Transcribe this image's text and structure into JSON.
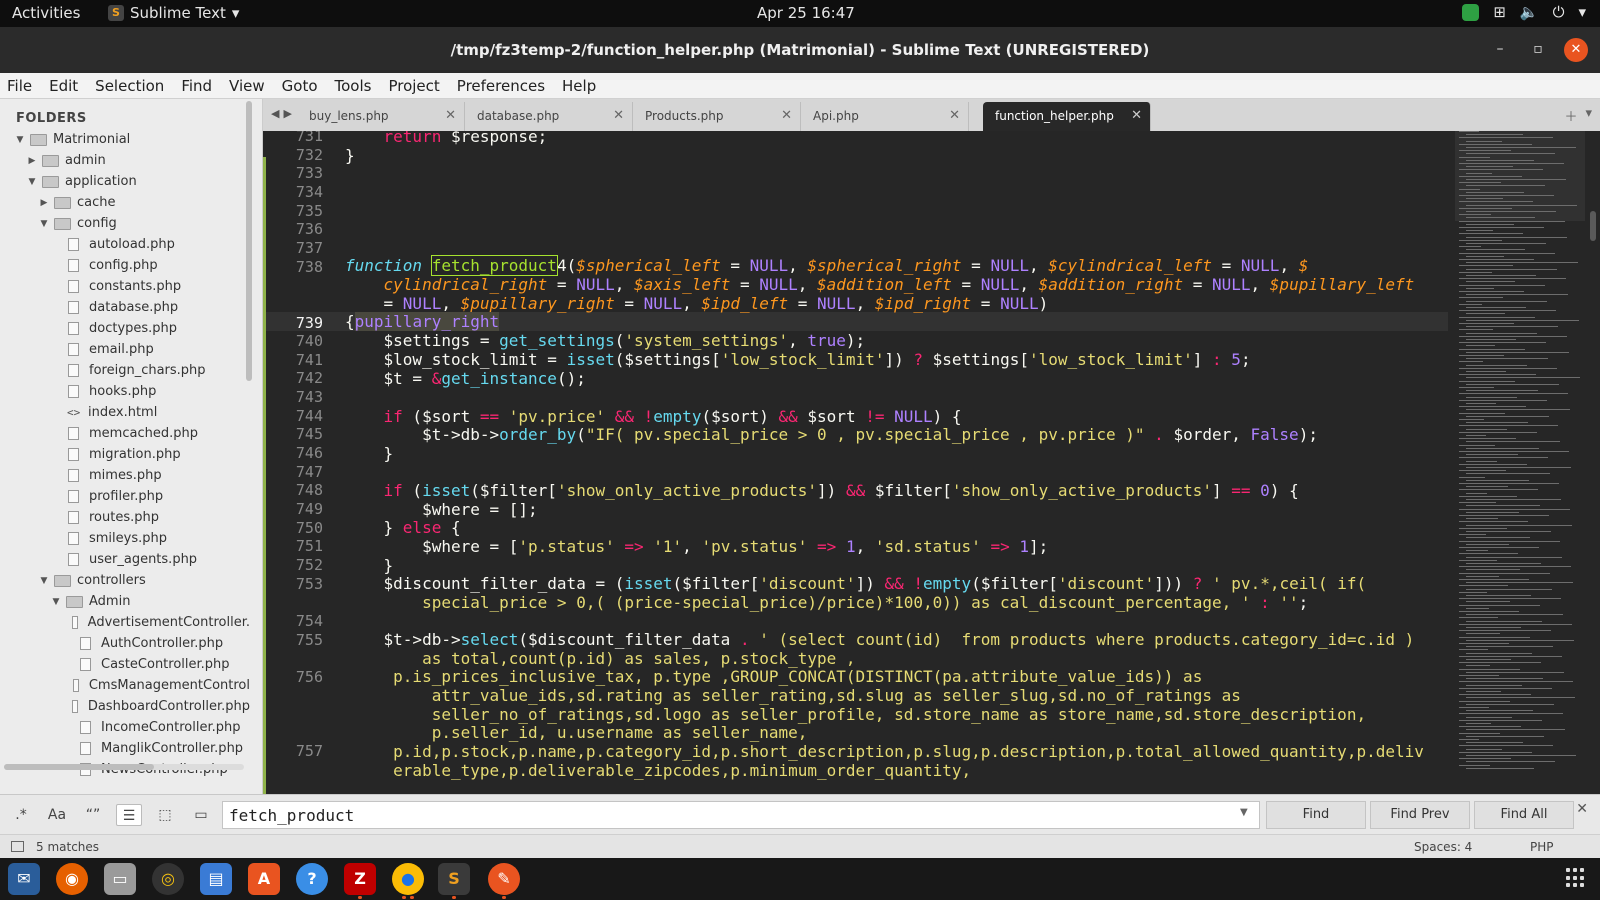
{
  "system_bar": {
    "activities": "Activities",
    "app_name": "Sublime Text",
    "clock": "Apr 25  16:47"
  },
  "window": {
    "title": "/tmp/fz3temp-2/function_helper.php (Matrimonial) - Sublime Text (UNREGISTERED)"
  },
  "menu": [
    "File",
    "Edit",
    "Selection",
    "Find",
    "View",
    "Goto",
    "Tools",
    "Project",
    "Preferences",
    "Help"
  ],
  "sidebar": {
    "header": "FOLDERS",
    "items": [
      {
        "label": "Matrimonial",
        "type": "folder",
        "depth": 0,
        "open": true
      },
      {
        "label": "admin",
        "type": "folder",
        "depth": 1,
        "open": false
      },
      {
        "label": "application",
        "type": "folder",
        "depth": 1,
        "open": true
      },
      {
        "label": "cache",
        "type": "folder",
        "depth": 2,
        "open": false
      },
      {
        "label": "config",
        "type": "folder",
        "depth": 2,
        "open": true
      },
      {
        "label": "autoload.php",
        "type": "file",
        "depth": 3
      },
      {
        "label": "config.php",
        "type": "file",
        "depth": 3
      },
      {
        "label": "constants.php",
        "type": "file",
        "depth": 3
      },
      {
        "label": "database.php",
        "type": "file",
        "depth": 3
      },
      {
        "label": "doctypes.php",
        "type": "file",
        "depth": 3
      },
      {
        "label": "email.php",
        "type": "file",
        "depth": 3
      },
      {
        "label": "foreign_chars.php",
        "type": "file",
        "depth": 3
      },
      {
        "label": "hooks.php",
        "type": "file",
        "depth": 3
      },
      {
        "label": "index.html",
        "type": "code",
        "depth": 3
      },
      {
        "label": "memcached.php",
        "type": "file",
        "depth": 3
      },
      {
        "label": "migration.php",
        "type": "file",
        "depth": 3
      },
      {
        "label": "mimes.php",
        "type": "file",
        "depth": 3
      },
      {
        "label": "profiler.php",
        "type": "file",
        "depth": 3
      },
      {
        "label": "routes.php",
        "type": "file",
        "depth": 3
      },
      {
        "label": "smileys.php",
        "type": "file",
        "depth": 3
      },
      {
        "label": "user_agents.php",
        "type": "file",
        "depth": 3
      },
      {
        "label": "controllers",
        "type": "folder",
        "depth": 2,
        "open": true
      },
      {
        "label": "Admin",
        "type": "folder",
        "depth": 3,
        "open": true
      },
      {
        "label": "AdvertisementController.",
        "type": "file",
        "depth": 4
      },
      {
        "label": "AuthController.php",
        "type": "file",
        "depth": 4
      },
      {
        "label": "CasteController.php",
        "type": "file",
        "depth": 4
      },
      {
        "label": "CmsManagementControl",
        "type": "file",
        "depth": 4
      },
      {
        "label": "DashboardController.php",
        "type": "file",
        "depth": 4
      },
      {
        "label": "IncomeController.php",
        "type": "file",
        "depth": 4
      },
      {
        "label": "ManglikController.php",
        "type": "file",
        "depth": 4
      },
      {
        "label": "NewsController.php",
        "type": "file",
        "depth": 4
      }
    ]
  },
  "tabs": [
    {
      "label": "buy_lens.php",
      "active": false
    },
    {
      "label": "database.php",
      "active": false
    },
    {
      "label": "Products.php",
      "active": false
    },
    {
      "label": "Api.php",
      "active": false
    },
    {
      "label": "function_helper.php",
      "active": true
    }
  ],
  "editor": {
    "line_numbers": [
      "731",
      "732",
      "733",
      "734",
      "735",
      "736",
      "737",
      "738",
      "",
      "",
      "739",
      "740",
      "741",
      "742",
      "743",
      "744",
      "745",
      "746",
      "747",
      "748",
      "749",
      "750",
      "751",
      "752",
      "753",
      "",
      "754",
      "755",
      "",
      "756",
      "",
      "",
      "",
      "757",
      ""
    ],
    "current_line": "739"
  },
  "find_panel": {
    "query": "fetch_product",
    "find_label": "Find",
    "find_prev_label": "Find Prev",
    "find_all_label": "Find All",
    "options": [
      ".*",
      "Aa",
      "“”",
      "☰",
      "⬚",
      "▭"
    ]
  },
  "status_bar": {
    "matches": "5 matches",
    "spaces": "Spaces: 4",
    "syntax": "PHP"
  },
  "colors": {
    "accent": "#e95420",
    "highlight": "#a6e22e"
  }
}
